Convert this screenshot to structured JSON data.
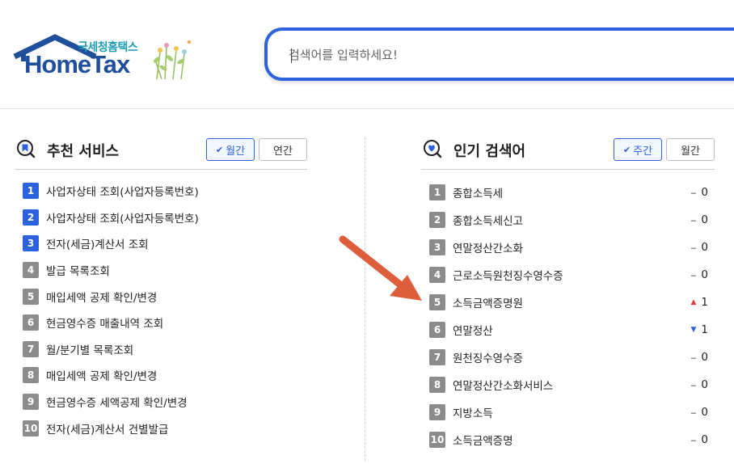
{
  "header": {
    "logo_sub": "국세청홈택스",
    "logo_main": "HomeTax",
    "search_placeholder": "검색어를 입력하세요!"
  },
  "recommended": {
    "title": "추천 서비스",
    "tab_monthly": "월간",
    "tab_yearly": "연간",
    "items": [
      {
        "rank": "1",
        "label": "사업자상태 조회(사업자등록번호)"
      },
      {
        "rank": "2",
        "label": "사업자상태 조회(사업자등록번호)"
      },
      {
        "rank": "3",
        "label": "전자(세금)계산서 조회"
      },
      {
        "rank": "4",
        "label": "발급 목록조회"
      },
      {
        "rank": "5",
        "label": "매입세액 공제 확인/변경"
      },
      {
        "rank": "6",
        "label": "현금영수증 매출내역 조회"
      },
      {
        "rank": "7",
        "label": "월/분기별 목록조회"
      },
      {
        "rank": "8",
        "label": "매입세액 공제 확인/변경"
      },
      {
        "rank": "9",
        "label": "현금영수증 세액공제 확인/변경"
      },
      {
        "rank": "10",
        "label": "전자(세금)계산서 건별발급"
      }
    ]
  },
  "popular": {
    "title": "인기 검색어",
    "tab_weekly": "주간",
    "tab_monthly": "월간",
    "items": [
      {
        "rank": "1",
        "label": "종합소득세",
        "change_symbol": "‒",
        "change": "0"
      },
      {
        "rank": "2",
        "label": "종합소득세신고",
        "change_symbol": "‒",
        "change": "0"
      },
      {
        "rank": "3",
        "label": "연말정산간소화",
        "change_symbol": "‒",
        "change": "0"
      },
      {
        "rank": "4",
        "label": "근로소득원천징수영수증",
        "change_symbol": "‒",
        "change": "0"
      },
      {
        "rank": "5",
        "label": "소득금액증명원",
        "change_symbol": "▲",
        "change": "1"
      },
      {
        "rank": "6",
        "label": "연말정산",
        "change_symbol": "▼",
        "change": "1"
      },
      {
        "rank": "7",
        "label": "원천징수영수증",
        "change_symbol": "‒",
        "change": "0"
      },
      {
        "rank": "8",
        "label": "연말정산간소화서비스",
        "change_symbol": "‒",
        "change": "0"
      },
      {
        "rank": "9",
        "label": "지방소득",
        "change_symbol": "‒",
        "change": "0"
      },
      {
        "rank": "10",
        "label": "소득금액증명",
        "change_symbol": "‒",
        "change": "0"
      }
    ]
  },
  "colors": {
    "brand_blue": "#2d62de",
    "logo_blue": "#1f4e9c",
    "annotation_arrow": "#dd5e3b",
    "rank_up": "#e23a3a",
    "rank_down": "#2d62de"
  }
}
